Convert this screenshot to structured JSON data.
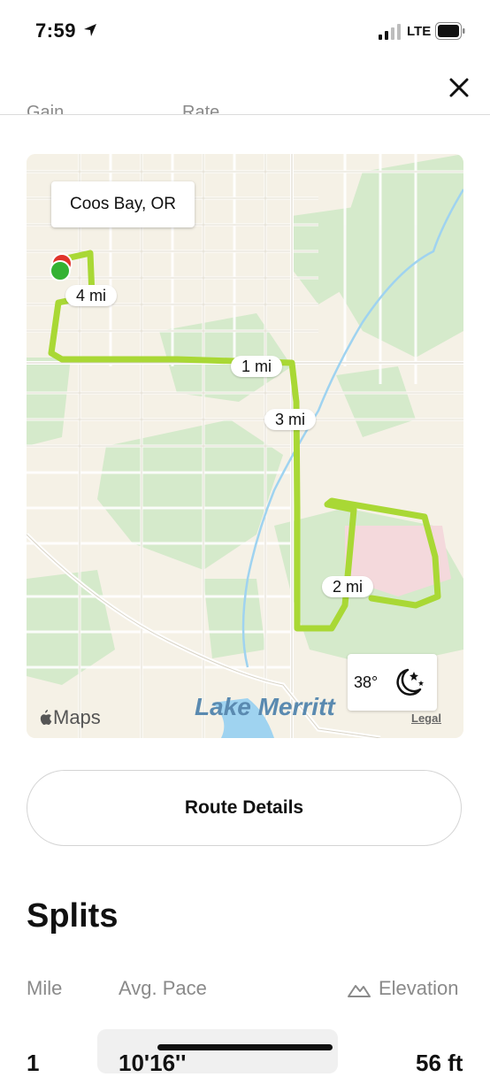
{
  "status_bar": {
    "time": "7:59",
    "network": "LTE",
    "icons": [
      "location-arrow-icon",
      "signal-icon",
      "battery-icon"
    ]
  },
  "header": {
    "close_icon": "close-icon",
    "clipped_labels": [
      "Gain",
      "Rate"
    ]
  },
  "map": {
    "location_callout": "Coos Bay, OR",
    "mile_markers": [
      "1 mi",
      "2 mi",
      "3 mi",
      "4 mi"
    ],
    "weather": {
      "temperature": "38°",
      "icon": "moon-stars-icon"
    },
    "maps_logo": "Maps",
    "legal": "Legal",
    "lake_label": "Lake Merritt",
    "colors": {
      "route": "#a9d835",
      "start": "#34b233",
      "end": "#e0332a",
      "water": "#9fd3f0",
      "park": "#cfe8c4"
    }
  },
  "route_details_button": "Route Details",
  "splits": {
    "title": "Splits",
    "columns": {
      "mile": "Mile",
      "pace": "Avg. Pace",
      "elevation": "Elevation"
    },
    "rows": [
      {
        "mile": "1",
        "pace": "10'16''",
        "elevation": "56 ft"
      }
    ]
  }
}
